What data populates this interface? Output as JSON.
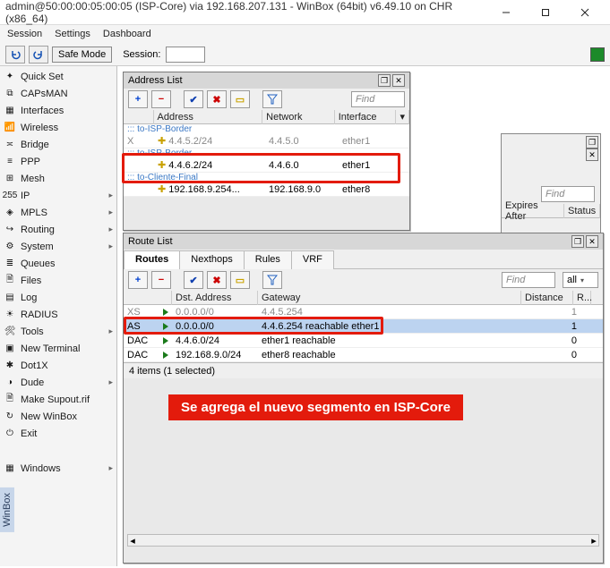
{
  "window": {
    "title": "admin@50:00:00:05:00:05 (ISP-Core) via 192.168.207.131 - WinBox (64bit) v6.49.10 on CHR (x86_64)"
  },
  "menubar": {
    "items": [
      "Session",
      "Settings",
      "Dashboard"
    ]
  },
  "toolbar": {
    "safe_mode": "Safe Mode",
    "session_label": "Session:"
  },
  "sidebar": {
    "items": [
      {
        "label": "Quick Set",
        "icon": "wand-icon",
        "sub": false
      },
      {
        "label": "CAPsMAN",
        "icon": "capsman-icon",
        "sub": false
      },
      {
        "label": "Interfaces",
        "icon": "interfaces-icon",
        "sub": false
      },
      {
        "label": "Wireless",
        "icon": "wireless-icon",
        "sub": false
      },
      {
        "label": "Bridge",
        "icon": "bridge-icon",
        "sub": false
      },
      {
        "label": "PPP",
        "icon": "ppp-icon",
        "sub": false
      },
      {
        "label": "Mesh",
        "icon": "mesh-icon",
        "sub": false
      },
      {
        "label": "IP",
        "icon": "ip-icon",
        "sub": true
      },
      {
        "label": "MPLS",
        "icon": "mpls-icon",
        "sub": true
      },
      {
        "label": "Routing",
        "icon": "routing-icon",
        "sub": true
      },
      {
        "label": "System",
        "icon": "system-icon",
        "sub": true
      },
      {
        "label": "Queues",
        "icon": "queues-icon",
        "sub": false
      },
      {
        "label": "Files",
        "icon": "files-icon",
        "sub": false
      },
      {
        "label": "Log",
        "icon": "log-icon",
        "sub": false
      },
      {
        "label": "RADIUS",
        "icon": "radius-icon",
        "sub": false
      },
      {
        "label": "Tools",
        "icon": "tools-icon",
        "sub": true
      },
      {
        "label": "New Terminal",
        "icon": "terminal-icon",
        "sub": false
      },
      {
        "label": "Dot1X",
        "icon": "dot1x-icon",
        "sub": false
      },
      {
        "label": "Dude",
        "icon": "dude-icon",
        "sub": true
      },
      {
        "label": "Make Supout.rif",
        "icon": "supout-icon",
        "sub": false
      },
      {
        "label": "New WinBox",
        "icon": "newwinbox-icon",
        "sub": false
      },
      {
        "label": "Exit",
        "icon": "exit-icon",
        "sub": false
      }
    ],
    "footer_item": {
      "label": "Windows",
      "icon": "windows-icon",
      "sub": true
    }
  },
  "vertical_tab": "WinBox",
  "address_list": {
    "title": "Address List",
    "find_placeholder": "Find",
    "columns": [
      "Address",
      "Network",
      "Interface"
    ],
    "rows": [
      {
        "flag": "",
        "comment": "::: to-ISP-Border",
        "address": "4.4.5.2/24",
        "network": "4.4.5.0",
        "interface": "ether1",
        "disabled": true
      },
      {
        "flag": "",
        "comment": "::: to-ISP-Border",
        "address": "4.4.6.2/24",
        "network": "4.4.6.0",
        "interface": "ether1",
        "disabled": false
      },
      {
        "flag": "",
        "comment": "::: to-Cliente-Final",
        "address": "192.168.9.254...",
        "network": "192.168.9.0",
        "interface": "ether8",
        "disabled": false
      }
    ]
  },
  "ghost_panel": {
    "find_placeholder": "Find",
    "columns": [
      "Expires After",
      "Status"
    ]
  },
  "route_list": {
    "title": "Route List",
    "tabs": [
      "Routes",
      "Nexthops",
      "Rules",
      "VRF"
    ],
    "active_tab": 0,
    "find_placeholder": "Find",
    "all_label": "all",
    "columns": [
      "Dst. Address",
      "Gateway",
      "Distance",
      "R..."
    ],
    "rows": [
      {
        "flag": "XS",
        "dst": "0.0.0.0/0",
        "gw": "4.4.5.254",
        "dist": "1",
        "r": "",
        "disabled": true,
        "selected": false
      },
      {
        "flag": "AS",
        "dst": "0.0.0.0/0",
        "gw": "4.4.6.254 reachable ether1",
        "dist": "1",
        "r": "",
        "disabled": false,
        "selected": true
      },
      {
        "flag": "DAC",
        "dst": "4.4.6.0/24",
        "gw": "ether1 reachable",
        "dist": "0",
        "r": "",
        "disabled": false,
        "selected": false
      },
      {
        "flag": "DAC",
        "dst": "192.168.9.0/24",
        "gw": "ether8 reachable",
        "dist": "0",
        "r": "",
        "disabled": false,
        "selected": false
      }
    ],
    "status": "4 items (1 selected)"
  },
  "annotation": "Se agrega el nuevo segmento en ISP-Core"
}
